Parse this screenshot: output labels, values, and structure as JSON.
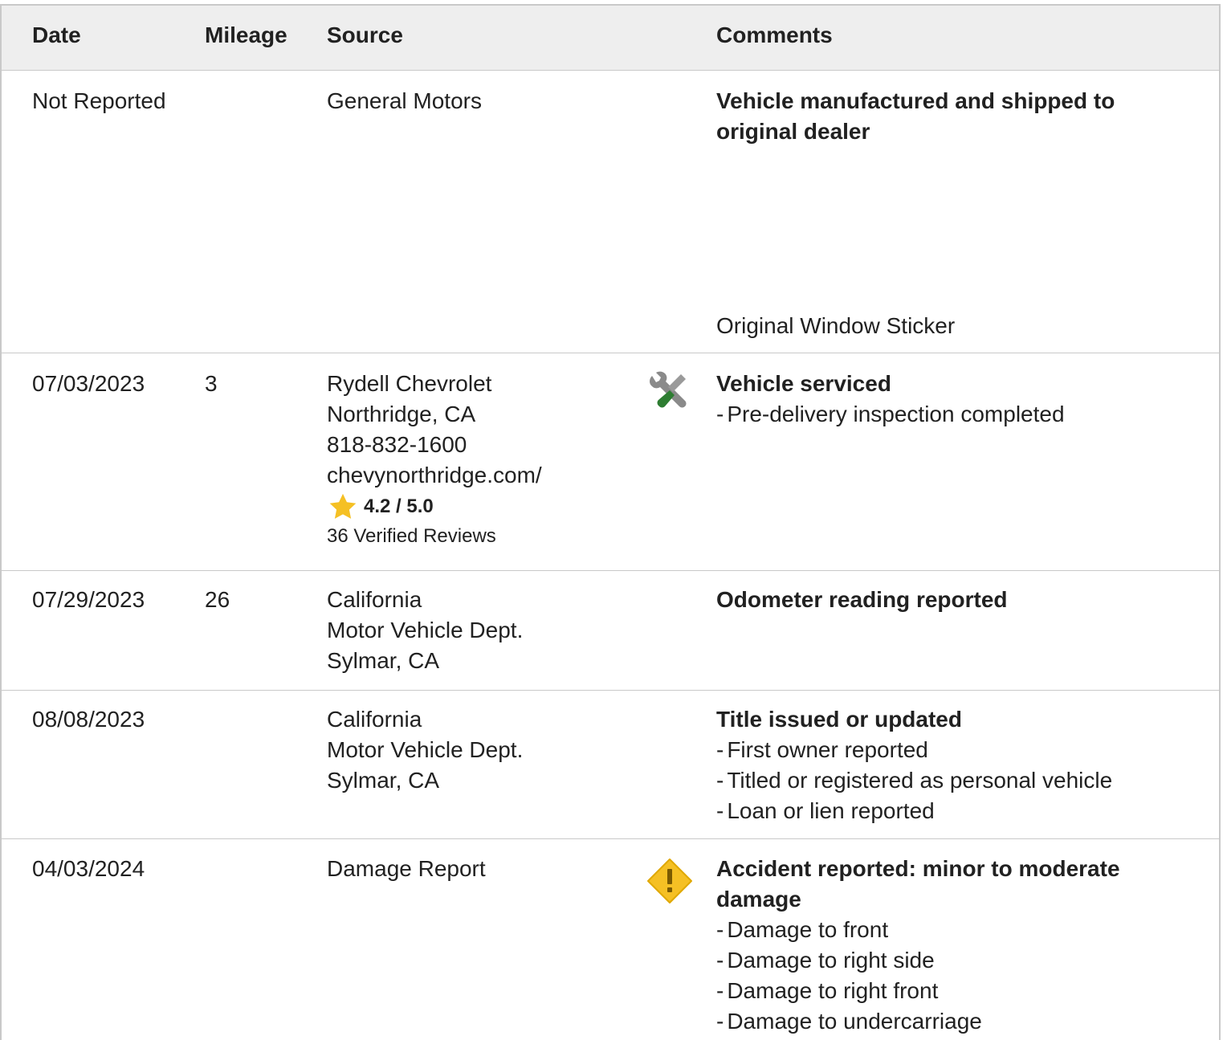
{
  "header": {
    "date": "Date",
    "mileage": "Mileage",
    "source": "Source",
    "comments": "Comments"
  },
  "rows": [
    {
      "date": "Not Reported",
      "mileage": "",
      "source_lines": [
        "General Motors"
      ],
      "icon": "",
      "comment_title_lines": [
        "Vehicle manufactured and shipped to",
        "original dealer"
      ],
      "details": [],
      "extra": "Original Window Sticker"
    },
    {
      "date": "07/03/2023",
      "mileage": "3",
      "source_lines": [
        "Rydell Chevrolet",
        "Northridge, CA",
        "818-832-1600",
        "chevynorthridge.com/"
      ],
      "rating": "4.2 / 5.0",
      "reviews": "36 Verified Reviews",
      "icon": "wrench-screwdriver-icon",
      "comment_title_lines": [
        "Vehicle serviced"
      ],
      "details": [
        "Pre-delivery inspection completed"
      ]
    },
    {
      "date": "07/29/2023",
      "mileage": "26",
      "source_lines": [
        "California",
        "Motor Vehicle Dept.",
        "Sylmar, CA"
      ],
      "icon": "",
      "comment_title_lines": [
        "Odometer reading reported"
      ],
      "details": []
    },
    {
      "date": "08/08/2023",
      "mileage": "",
      "source_lines": [
        "California",
        "Motor Vehicle Dept.",
        "Sylmar, CA"
      ],
      "icon": "",
      "comment_title_lines": [
        "Title issued or updated"
      ],
      "details": [
        "First owner reported",
        "Titled or registered as personal vehicle",
        "Loan or lien reported"
      ]
    },
    {
      "date": "04/03/2024",
      "mileage": "",
      "source_lines": [
        "Damage Report"
      ],
      "icon": "warning-diamond-icon",
      "comment_title_lines": [
        "Accident reported: minor to moderate",
        "damage"
      ],
      "details": [
        "Damage to front",
        "Damage to right side",
        "Damage to right front",
        "Damage to undercarriage"
      ]
    }
  ],
  "colors": {
    "header_bg": "#eeeeee",
    "border": "#c9c9c9",
    "star": "#f5c024",
    "warning": "#f5c024",
    "service_green": "#2e7d32"
  }
}
